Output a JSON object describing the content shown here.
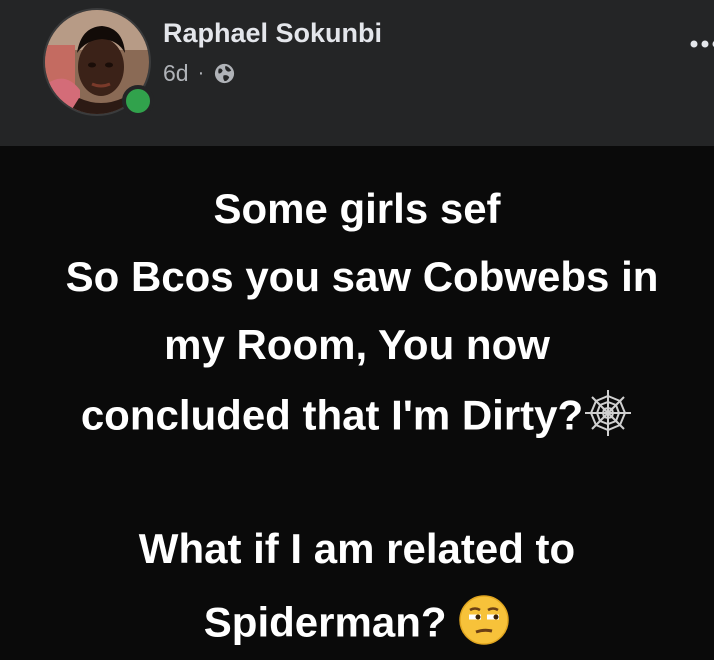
{
  "post": {
    "author": "Raphael Sokunbi",
    "time": "6d",
    "separator": "·",
    "privacy_icon": "globe-icon",
    "more_icon": "more-options-icon",
    "online_status_color": "#31a24c",
    "text": {
      "line1": "Some girls sef",
      "line2": "So Bcos you saw Cobwebs in",
      "line3": "my Room, You now",
      "line4": "concluded that I'm Dirty?",
      "line5": "What if I am related to",
      "line6": "Spiderman?"
    },
    "emojis": {
      "cobweb": "cobweb-emoji",
      "face": "unamused-face-emoji"
    }
  }
}
